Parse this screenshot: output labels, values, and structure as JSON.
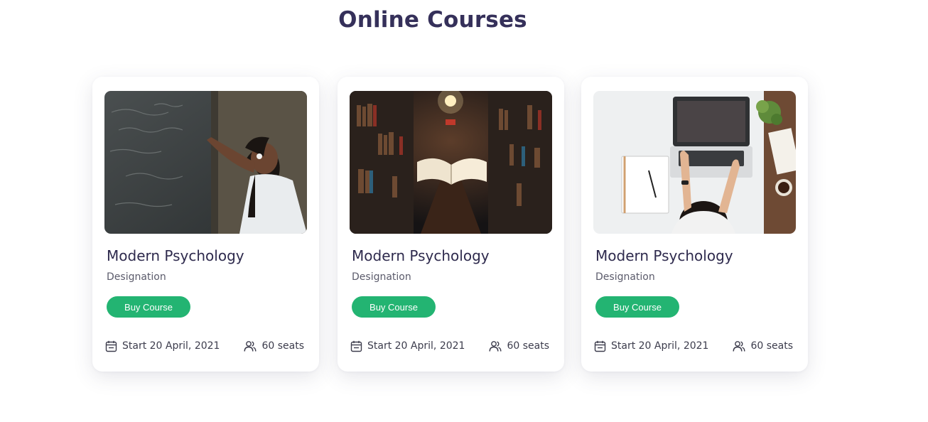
{
  "section": {
    "title": "Online Courses"
  },
  "colors": {
    "title": "#35305a",
    "accent": "#23b472",
    "text": "#2e2a4d"
  },
  "cards": [
    {
      "image": "chalkboard-student-photo",
      "title": "Modern Psychology",
      "designation": "Designation",
      "button": "Buy Course",
      "date": "Start 20  April, 2021",
      "seats": "60 seats",
      "date_icon": "calendar-icon",
      "seats_icon": "users-icon"
    },
    {
      "image": "library-flying-book-photo",
      "title": "Modern Psychology",
      "designation": "Designation",
      "button": "Buy Course",
      "date": "Start 20  April, 2021",
      "seats": "60 seats",
      "date_icon": "calendar-icon",
      "seats_icon": "users-icon"
    },
    {
      "image": "laptop-desk-photo",
      "title": "Modern Psychology",
      "designation": "Designation",
      "button": "Buy Course",
      "date": "Start 20  April, 2021",
      "seats": "60 seats",
      "date_icon": "calendar-icon",
      "seats_icon": "users-icon"
    }
  ]
}
